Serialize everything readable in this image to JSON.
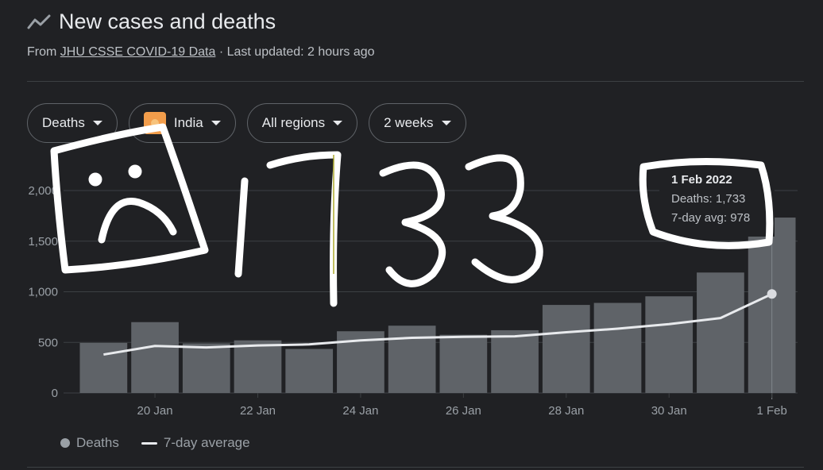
{
  "header": {
    "title": "New cases and deaths",
    "source_prefix": "From ",
    "source_link": "JHU CSSE COVID-19 Data",
    "source_suffix": " · Last updated: 2 hours ago"
  },
  "filters": {
    "metric": "Deaths",
    "country": "India",
    "region": "All regions",
    "range": "2 weeks"
  },
  "tooltip": {
    "date": "1 Feb 2022",
    "deaths_line": "Deaths: 1,733",
    "avg_line": "7-day avg: 978"
  },
  "legend": {
    "deaths": "Deaths",
    "avg": "7-day average"
  },
  "annotation": {
    "handwritten_text": "1733"
  },
  "colors": {
    "bar": "#5f6368",
    "avg_line": "#e8eaed",
    "grid": "#3c4043",
    "axis_text": "#9aa0a6",
    "scribble": "#ffffff"
  },
  "chart_data": {
    "type": "bar",
    "categories": [
      "19 Jan",
      "20 Jan",
      "21 Jan",
      "22 Jan",
      "23 Jan",
      "24 Jan",
      "25 Jan",
      "26 Jan",
      "27 Jan",
      "28 Jan",
      "29 Jan",
      "30 Jan",
      "31 Jan",
      "1 Feb"
    ],
    "x_tick_labels": [
      "20 Jan",
      "22 Jan",
      "24 Jan",
      "26 Jan",
      "28 Jan",
      "30 Jan",
      "1 Feb"
    ],
    "series": [
      {
        "name": "Deaths",
        "type": "bar",
        "values": [
          495,
          700,
          490,
          520,
          435,
          610,
          665,
          575,
          620,
          870,
          890,
          955,
          1190,
          1733
        ]
      },
      {
        "name": "7-day average",
        "type": "line",
        "values": [
          380,
          465,
          450,
          470,
          480,
          520,
          545,
          555,
          560,
          600,
          635,
          680,
          740,
          978
        ]
      }
    ],
    "yticks": [
      0,
      500,
      1000,
      1500,
      2000
    ],
    "ytick_labels": [
      "0",
      "500",
      "1,000",
      "1,500",
      "2,000"
    ],
    "ylim": [
      0,
      2000
    ],
    "grid": true,
    "legend_position": "bottom-left"
  }
}
